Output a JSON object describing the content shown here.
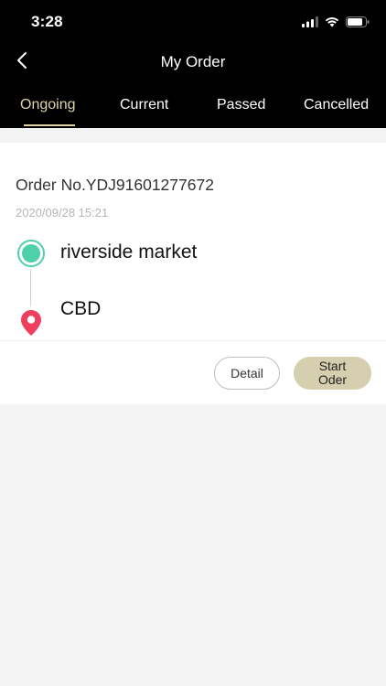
{
  "status": {
    "time": "3:28"
  },
  "header": {
    "title": "My Order"
  },
  "tabs": [
    {
      "label": "Ongoing",
      "active": true
    },
    {
      "label": "Current",
      "active": false
    },
    {
      "label": "Passed",
      "active": false
    },
    {
      "label": "Cancelled",
      "active": false
    }
  ],
  "order": {
    "number": "Order No.YDJ91601277672",
    "datetime": "2020/09/28 15:21",
    "origin": "riverside market",
    "destination": "CBD",
    "actions": {
      "detail_label": "Detail",
      "start_label": "Start Oder"
    }
  },
  "colors": {
    "accent": "#ddd3a9",
    "origin_marker": "#4ed1a8",
    "destination_marker": "#ee3f5f",
    "start_button": "#d6cfaf"
  }
}
